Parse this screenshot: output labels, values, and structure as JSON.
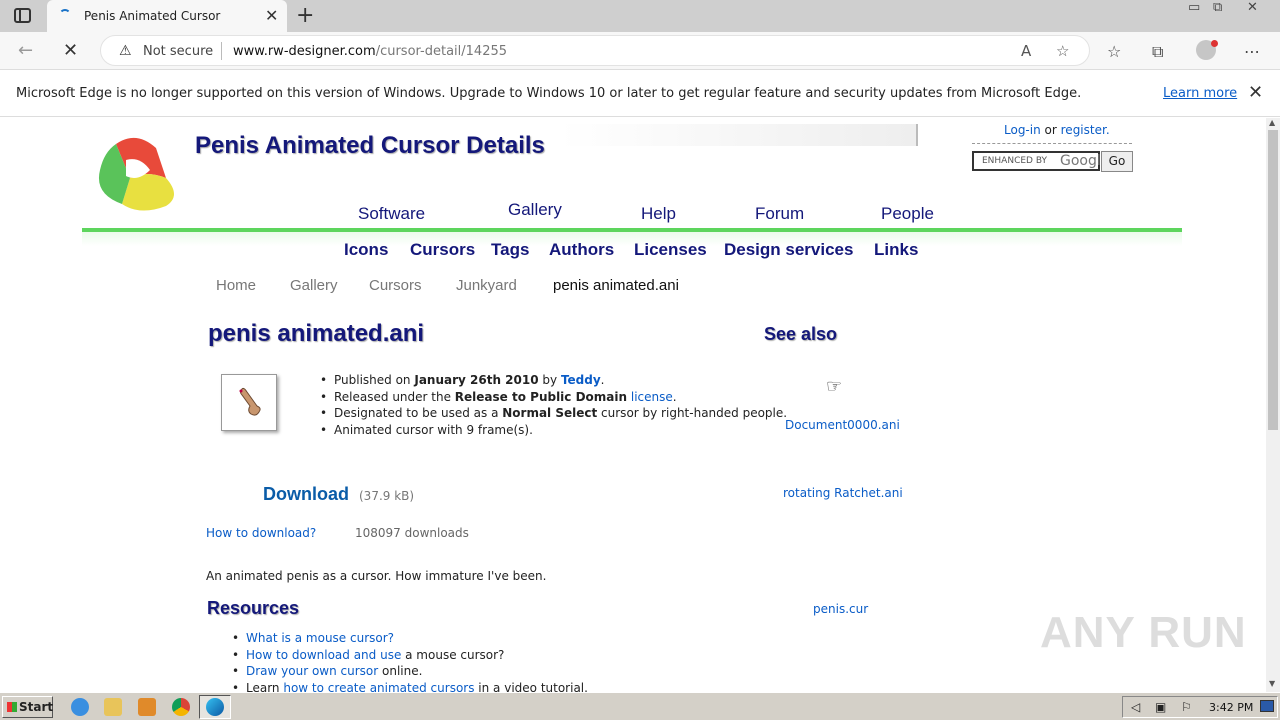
{
  "browser": {
    "tab_title": "Penis Animated Cursor",
    "address_not_secure": "Not secure",
    "url_host": "www.rw-designer.com",
    "url_path": "/cursor-detail/14255",
    "infobar_text": "Microsoft Edge is no longer supported on this version of Windows. Upgrade to Windows 10 or later to get regular feature and security updates from Microsoft Edge.",
    "infobar_link": "Learn more"
  },
  "site": {
    "header_title": "Penis Animated Cursor Details",
    "login": "Log-in",
    "or": "or",
    "register": "register.",
    "search_placeholder": "ENHANCED BY",
    "search_brand": "Googl",
    "go": "Go",
    "main_nav": [
      "Software",
      "Gallery",
      "Help",
      "Forum",
      "People"
    ],
    "sub_nav": [
      "Icons",
      "Cursors",
      "Tags",
      "Authors",
      "Licenses",
      "Design services",
      "Links"
    ],
    "breadcrumb": [
      "Home",
      "Gallery",
      "Cursors",
      "Junkyard",
      "penis animated.ani"
    ]
  },
  "detail": {
    "title": "penis animated.ani",
    "see_also": "See also",
    "facts": {
      "published_prefix": "Published on ",
      "published_date": "January 26th 2010",
      "by": " by ",
      "author": "Teddy",
      "released_prefix": "Released under the ",
      "license_name": "Release to Public Domain",
      "license_link": "license",
      "designated_prefix": "Designated to be used as a ",
      "cursor_role": "Normal Select",
      "designated_suffix": " cursor by right-handed people.",
      "frames": "Animated cursor with 9 frame(s)."
    },
    "see_also_items": [
      "Document0000.ani",
      "rotating Ratchet.ani",
      "penis.cur"
    ],
    "download": "Download",
    "download_size": "(37.9 kB)",
    "how_to_download": "How to download?",
    "download_count": "108097 downloads",
    "description": "An animated penis as a cursor. How immature I've been.",
    "resources_title": "Resources",
    "resources": {
      "r1_link": "What is a mouse cursor?",
      "r2_link": "How to download and use",
      "r2_suffix": " a mouse cursor?",
      "r3_link": "Draw your own cursor",
      "r3_suffix": " online.",
      "r4_prefix": "Learn ",
      "r4_link": "how to create animated cursors",
      "r4_suffix": " in a video tutorial."
    }
  },
  "watermark": "ANY RUN",
  "taskbar": {
    "start": "Start",
    "clock": "3:42 PM"
  }
}
